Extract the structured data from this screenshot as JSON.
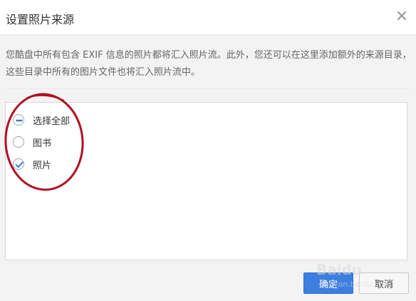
{
  "dialog": {
    "title": "设置照片来源",
    "description": "您酷盘中所有包含 EXIF 信息的照片都将汇入照片流。此外，您还可以在这里添加额外的来源目录，这些目录中所有的图片文件也将汇入照片流中。"
  },
  "folders": [
    {
      "label": "选择全部",
      "state": "partial"
    },
    {
      "label": "图书",
      "state": "unchecked"
    },
    {
      "label": "照片",
      "state": "checked"
    }
  ],
  "buttons": {
    "ok_label": "确定",
    "cancel_label": "取消"
  },
  "watermark": {
    "brand": "Baidu",
    "site": "jingyan.baidu.com"
  },
  "colors": {
    "accent": "#3d7fe0",
    "annotation": "#b01020",
    "check": "#2f7bd8"
  },
  "icons": {
    "close": "close-icon",
    "partial": "partial-check-icon",
    "checked": "checkmark-icon"
  }
}
